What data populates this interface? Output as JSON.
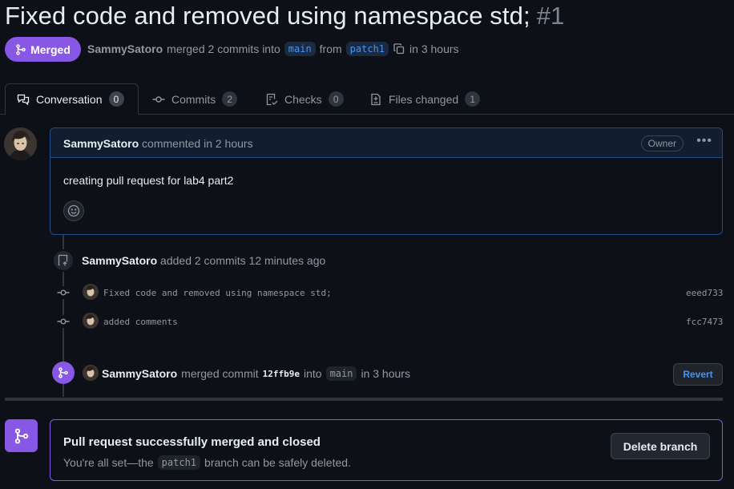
{
  "pr": {
    "title": "Fixed code and removed using namespace std;",
    "number": "#1",
    "status": "Merged",
    "author": "SammySatoro",
    "merged_text": "merged 2 commits into",
    "base_branch": "main",
    "from_text": "from",
    "head_branch": "patch1",
    "time_text": "in 3 hours"
  },
  "tabs": [
    {
      "label": "Conversation",
      "count": "0",
      "icon": "conversation-icon"
    },
    {
      "label": "Commits",
      "count": "2",
      "icon": "commit-icon"
    },
    {
      "label": "Checks",
      "count": "0",
      "icon": "checklist-icon"
    },
    {
      "label": "Files changed",
      "count": "1",
      "icon": "file-diff-icon"
    }
  ],
  "comment": {
    "author": "SammySatoro",
    "action": "commented in 2 hours",
    "role": "Owner",
    "body": "creating pull request for lab4 part2"
  },
  "push_event": {
    "author": "SammySatoro",
    "text": "added 2 commits 12 minutes ago"
  },
  "commits": [
    {
      "message": "Fixed code and removed using namespace std;",
      "sha": "eeed733"
    },
    {
      "message": "added comments",
      "sha": "fcc7473"
    }
  ],
  "merge_event": {
    "author": "SammySatoro",
    "text": "merged commit",
    "commit": "12ffb9e",
    "into": "into",
    "branch": "main",
    "time": "in 3 hours",
    "revert_label": "Revert"
  },
  "merged_box": {
    "title": "Pull request successfully merged and closed",
    "sub_before": "You're all set—the",
    "branch": "patch1",
    "sub_after": "branch can be safely deleted.",
    "delete_label": "Delete branch"
  },
  "colors": {
    "merged_purple": "#8957e5",
    "link_blue": "#4493f8",
    "background": "#0d1117"
  }
}
